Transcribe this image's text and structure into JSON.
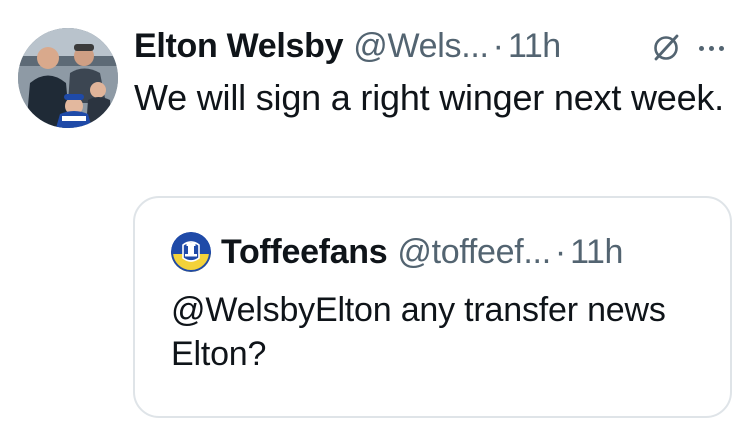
{
  "tweet": {
    "author": {
      "display_name": "Elton Welsby",
      "handle": "@Wels...",
      "avatar_icon": "profile-photo"
    },
    "separator": "·",
    "time": "11h",
    "text": "We will sign a right winger next week.",
    "actions": {
      "grok_icon": "grok-icon",
      "more_icon": "more-options-icon"
    },
    "quoted_tweet": {
      "author": {
        "display_name": "Toffeefans",
        "handle": "@toffeef...",
        "avatar_icon": "everton-crest-icon"
      },
      "separator": "·",
      "time": "11h",
      "text": "@WelsbyElton any transfer news Elton?"
    }
  },
  "colors": {
    "primary_text": "#0f1419",
    "secondary_text": "#536471",
    "border": "#dfe4e8",
    "everton_blue": "#1f4aa8",
    "crest_yellow": "#f3d23a"
  }
}
